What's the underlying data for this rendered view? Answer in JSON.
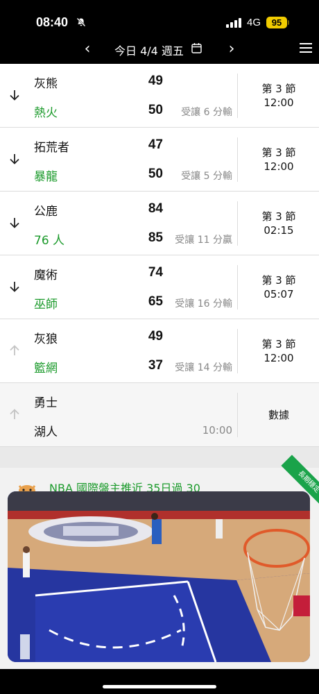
{
  "status_bar": {
    "time": "08:40",
    "network": "4G",
    "battery": "95"
  },
  "date_nav": {
    "prev": "‹",
    "next": "›",
    "date_label": "今日 4/4 週五"
  },
  "games": [
    {
      "away": "灰熊",
      "home": "熱火",
      "away_score": "49",
      "home_score": "50",
      "spread": "受讓 6 分輸",
      "period": "第 3 節",
      "clock": "12:00",
      "arrow": "down"
    },
    {
      "away": "拓荒者",
      "home": "暴龍",
      "away_score": "47",
      "home_score": "50",
      "spread": "受讓 5 分輸",
      "period": "第 3 節",
      "clock": "12:00",
      "arrow": "down"
    },
    {
      "away": "公鹿",
      "home": "76 人",
      "away_score": "84",
      "home_score": "85",
      "spread": "受讓 11 分贏",
      "period": "第 3 節",
      "clock": "02:15",
      "arrow": "down"
    },
    {
      "away": "魔術",
      "home": "巫師",
      "away_score": "74",
      "home_score": "65",
      "spread": "受讓 16 分輸",
      "period": "第 3 節",
      "clock": "05:07",
      "arrow": "down"
    },
    {
      "away": "灰狼",
      "home": "籃網",
      "away_score": "49",
      "home_score": "37",
      "spread": "受讓 14 分輸",
      "period": "第 3 節",
      "clock": "12:00",
      "arrow": "up"
    }
  ],
  "upcoming": {
    "away": "勇士",
    "home": "湖人",
    "time": "10:00",
    "action": "數據"
  },
  "promo": {
    "title": "NBA 國際盤主推近 35日過 30",
    "tag": "長期穩定"
  },
  "colors": {
    "home_team": "#1b9a2b",
    "battery": "#f1cc00",
    "court_blue": "#2b3aa8"
  }
}
